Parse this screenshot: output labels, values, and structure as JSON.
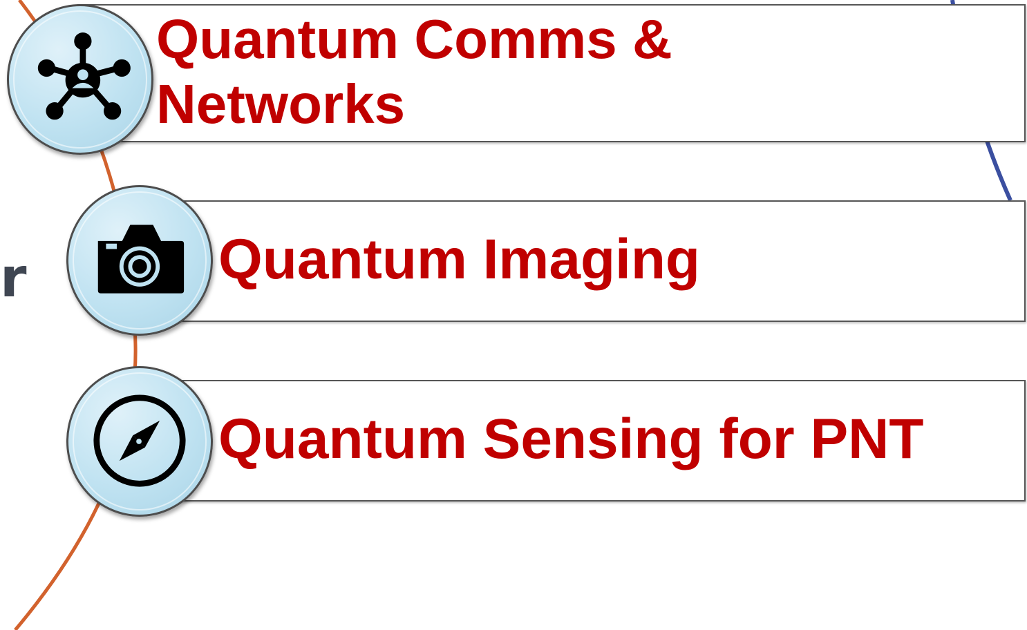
{
  "side_text": "r",
  "items": [
    {
      "label": "Quantum Comms & Networks",
      "icon": "network-nodes-icon"
    },
    {
      "label": "Quantum Imaging",
      "icon": "camera-icon"
    },
    {
      "label": "Quantum Sensing for PNT",
      "icon": "compass-icon"
    }
  ],
  "colors": {
    "label": "#c00000",
    "icon_fill": "#bfe2f1",
    "arc_left": "#d2622d",
    "arc_right": "#3b4fa0",
    "side_text": "#3f4652"
  }
}
